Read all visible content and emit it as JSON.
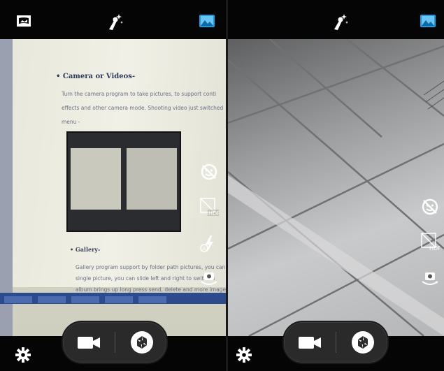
{
  "left_pane": {
    "top_icons": [
      "panorama-icon",
      "effects-magic-wand-icon",
      "gallery-thumbnail-icon"
    ],
    "document": {
      "heading": "• Camera or Videos-",
      "body_lines": [
        "Turn the camera program to take pictures, to support conti",
        "effects and other camera mode. Shooting video just switched",
        "menu -"
      ],
      "gallery_heading": "• Gallery-",
      "gallery_lines": [
        "Gallery program support by folder path pictures, you can double",
        "single picture, you can slide left and right to switch a",
        "album brings up long press send, delete and more image operations"
      ]
    },
    "side_tools": [
      "face-beauty-off-icon",
      "hdr-icon",
      "flash-auto-icon",
      "switch-camera-icon"
    ],
    "controls": {
      "settings": "settings-gear-icon",
      "video": "video-record-icon",
      "shutter": "shutter-icon"
    }
  },
  "right_pane": {
    "top_icons": [
      "effects-magic-wand-icon",
      "gallery-thumbnail-icon"
    ],
    "side_tools": [
      "face-beauty-off-icon",
      "hdr-icon",
      "switch-camera-icon"
    ],
    "controls": {
      "settings": "settings-gear-icon",
      "video": "video-record-icon",
      "shutter": "shutter-icon"
    }
  },
  "labels": {
    "hdr": "HDR",
    "flash_mode": "A"
  },
  "colors": {
    "bar_background": "#050505",
    "icon_white": "#ffffff",
    "gallery_blue": "#1e9be0",
    "pill_background": "#2a2a2a"
  }
}
